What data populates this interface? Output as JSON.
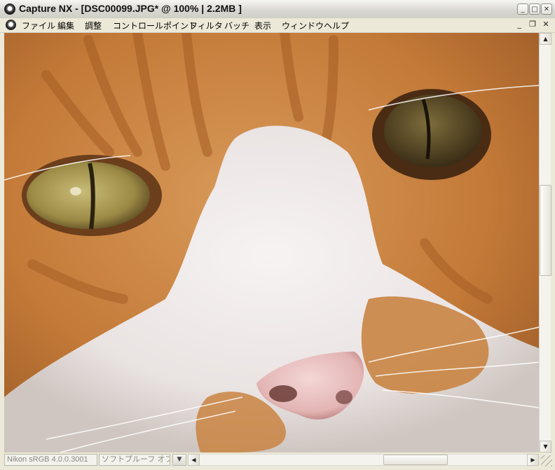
{
  "window": {
    "title": "Capture NX - [DSC00099.JPG* @ 100% | 2.2MB ]",
    "controls": {
      "minimize": "_",
      "maximize": "□",
      "close": "✕"
    }
  },
  "menubar": {
    "items": [
      "ファイル",
      "編集",
      "調整",
      "コントロールポイント",
      "フィルタ",
      "バッチ",
      "表示",
      "ウィンドウ",
      "ヘルプ"
    ],
    "mdi_controls": {
      "minimize": "_",
      "restore": "❐",
      "close": "✕"
    }
  },
  "document": {
    "image_icon": "photo-canvas",
    "colors": {
      "fur_orange": "#c9813f",
      "fur_white": "#efe9e6",
      "nose_pink": "#e9c3c3",
      "eye_olive": "#9b8a45"
    }
  },
  "statusbar": {
    "color_profile": "Nikon sRGB 4.0.0.3001",
    "soft_proof": "ソフトプルーフ オフ",
    "dropdown_icon": "▼",
    "scroll_left": "◀",
    "scroll_right": "▶"
  },
  "scrollbars": {
    "vertical_position": 0.46,
    "horizontal_position": 0.58,
    "scroll_up": "▲",
    "scroll_down": "▼"
  }
}
